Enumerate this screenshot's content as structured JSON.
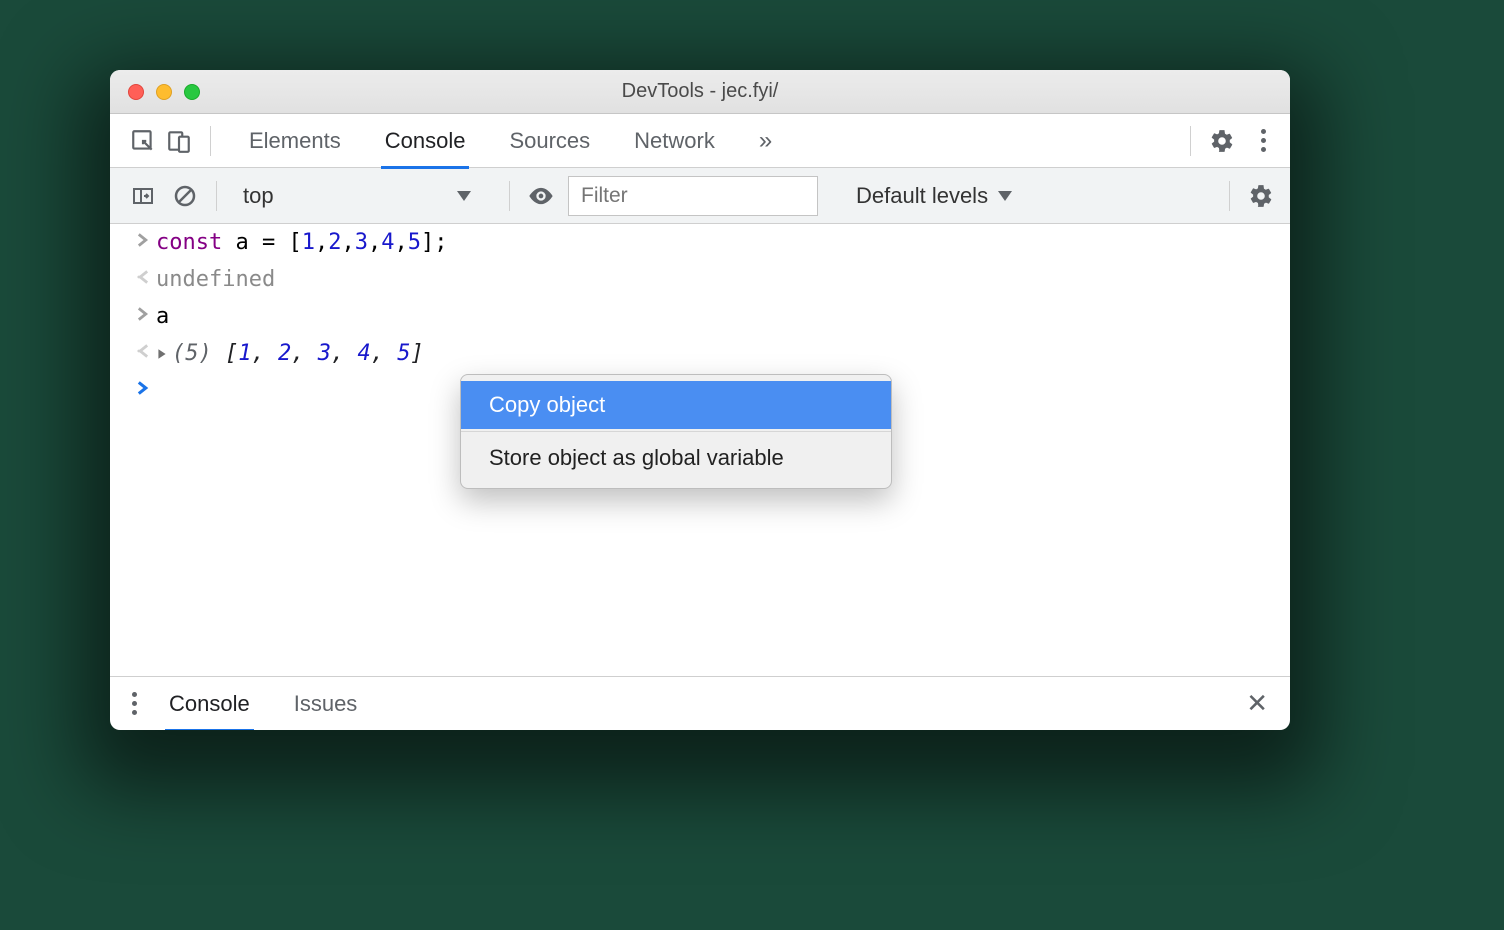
{
  "window": {
    "title": "DevTools - jec.fyi/"
  },
  "tabs": {
    "items": [
      "Elements",
      "Console",
      "Sources",
      "Network"
    ],
    "active": "Console",
    "overflow_glyph": "»"
  },
  "filterbar": {
    "context": "top",
    "filter_placeholder": "Filter",
    "levels_label": "Default levels"
  },
  "console": {
    "lines": [
      {
        "kind": "input",
        "tokens": [
          {
            "t": "const ",
            "c": "kw"
          },
          {
            "t": "a = [",
            "c": ""
          },
          {
            "t": "1",
            "c": "num"
          },
          {
            "t": ",",
            "c": ""
          },
          {
            "t": "2",
            "c": "num"
          },
          {
            "t": ",",
            "c": ""
          },
          {
            "t": "3",
            "c": "num"
          },
          {
            "t": ",",
            "c": ""
          },
          {
            "t": "4",
            "c": "num"
          },
          {
            "t": ",",
            "c": ""
          },
          {
            "t": "5",
            "c": "num"
          },
          {
            "t": "];",
            "c": ""
          }
        ]
      },
      {
        "kind": "output",
        "tokens": [
          {
            "t": "undefined",
            "c": "und"
          }
        ]
      },
      {
        "kind": "input",
        "tokens": [
          {
            "t": "a",
            "c": ""
          }
        ]
      },
      {
        "kind": "output-obj",
        "len": "(5)",
        "open": "[",
        "vals": [
          "1",
          "2",
          "3",
          "4",
          "5"
        ],
        "close": "]"
      },
      {
        "kind": "prompt"
      }
    ]
  },
  "context_menu": {
    "items": [
      {
        "label": "Copy object",
        "highlighted": true
      },
      {
        "label": "Store object as global variable",
        "highlighted": false
      }
    ]
  },
  "drawer": {
    "tabs": [
      "Console",
      "Issues"
    ],
    "active": "Console"
  }
}
